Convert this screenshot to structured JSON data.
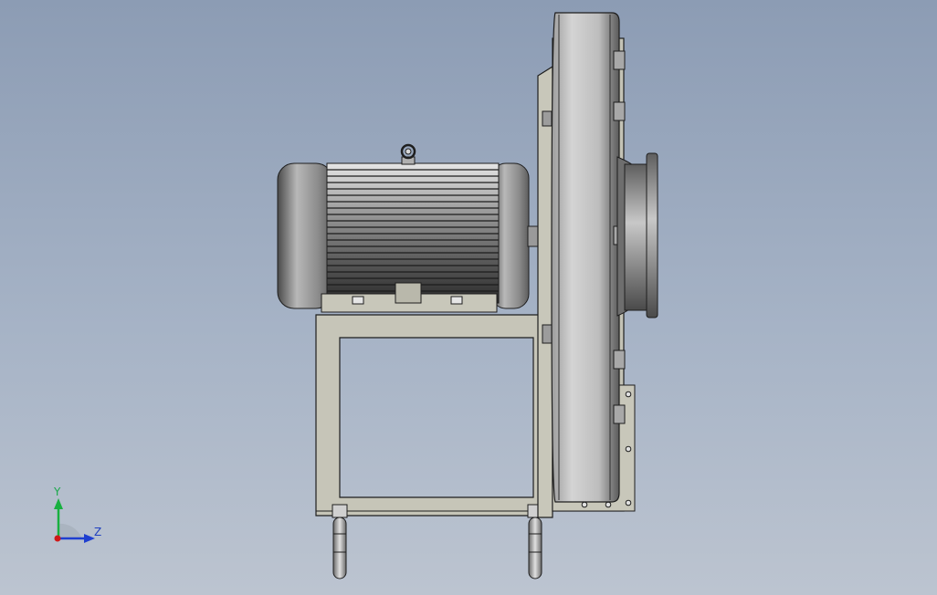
{
  "viewport": {
    "background_top": "#8c9cb4",
    "background_bottom": "#bcc4d0"
  },
  "triad": {
    "y_label": "Y",
    "z_label": "Z",
    "colors": {
      "x": "#d01818",
      "y": "#18b040",
      "z": "#1f3fd0"
    }
  },
  "model": {
    "parts": [
      "motor",
      "motor-base-frame",
      "blower-housing",
      "inlet-flange",
      "support-legs"
    ],
    "edge_color": "#1e1e1e",
    "face_color": "#c6c5b8"
  }
}
